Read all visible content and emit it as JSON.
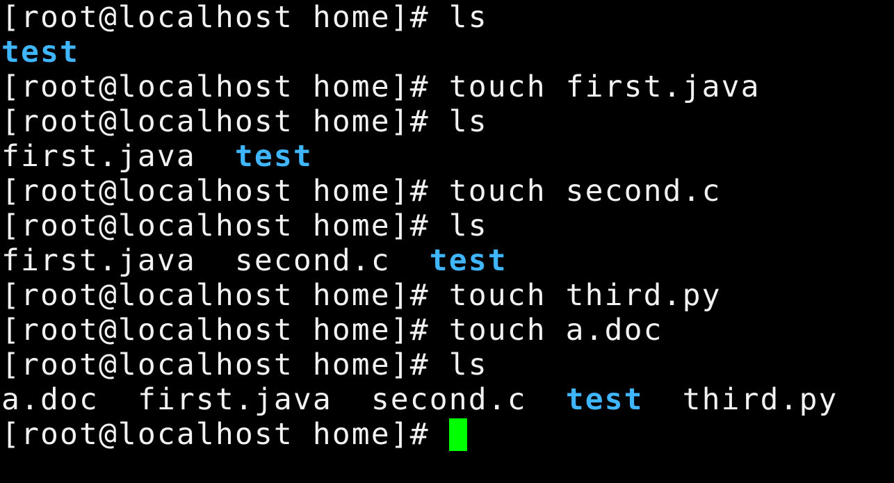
{
  "terminal": {
    "prompt": "[root@localhost home]#",
    "lines": [
      {
        "type": "cmd",
        "command": "ls"
      },
      {
        "type": "out",
        "tokens": [
          {
            "text": "test",
            "kind": "dir"
          }
        ]
      },
      {
        "type": "cmd",
        "command": "touch first.java"
      },
      {
        "type": "cmd",
        "command": "ls"
      },
      {
        "type": "out",
        "tokens": [
          {
            "text": "first.java",
            "kind": "file"
          },
          {
            "text": "test",
            "kind": "dir"
          }
        ]
      },
      {
        "type": "cmd",
        "command": "touch second.c"
      },
      {
        "type": "cmd",
        "command": "ls"
      },
      {
        "type": "out",
        "tokens": [
          {
            "text": "first.java",
            "kind": "file"
          },
          {
            "text": "second.c",
            "kind": "file"
          },
          {
            "text": "test",
            "kind": "dir"
          }
        ]
      },
      {
        "type": "cmd",
        "command": "touch third.py"
      },
      {
        "type": "cmd",
        "command": "touch a.doc"
      },
      {
        "type": "cmd",
        "command": "ls"
      },
      {
        "type": "out",
        "tokens": [
          {
            "text": "a.doc",
            "kind": "file"
          },
          {
            "text": "first.java",
            "kind": "file"
          },
          {
            "text": "second.c",
            "kind": "file"
          },
          {
            "text": "test",
            "kind": "dir"
          },
          {
            "text": "third.py",
            "kind": "file"
          }
        ]
      },
      {
        "type": "cmd",
        "command": "",
        "cursor": true
      }
    ],
    "colors": {
      "background": "#000000",
      "text": "#f2f2f2",
      "directory": "#3fb6ff",
      "cursor": "#00ff00"
    }
  }
}
